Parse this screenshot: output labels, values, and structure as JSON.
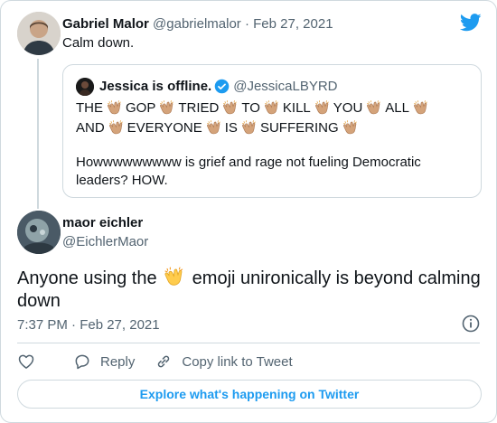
{
  "colors": {
    "twitter_blue": "#1d9bf0",
    "muted_text": "#536471",
    "border": "#cfd9de"
  },
  "parent_tweet": {
    "display_name": "Gabriel Malor",
    "handle": "@gabrielmalor",
    "separator": " · ",
    "date": "Feb 27, 2021",
    "text": "Calm down.",
    "quoted_tweet": {
      "display_name": "Jessica is offline.",
      "handle": "@JessicaLBYRD",
      "line1": [
        "THE",
        "GOP",
        "TRIED",
        "TO",
        "KILL",
        "YOU",
        "ALL"
      ],
      "line2": [
        "AND",
        "EVERYONE",
        "IS",
        "SUFFERING"
      ],
      "paragraph": "Howwwwwwwww is grief and rage not fueling Democratic leaders? HOW."
    }
  },
  "main_tweet": {
    "display_name": "maor eichler",
    "handle": "@EichlerMaor",
    "text_before": "Anyone using the ",
    "text_after": " emoji unironically is beyond calming down",
    "timestamp": "7:37 PM · Feb 27, 2021"
  },
  "actions": {
    "reply_label": "Reply",
    "copy_link_label": "Copy link to Tweet"
  },
  "explore_button_label": "Explore what's happening on Twitter",
  "icons": [
    "twitter-bird-icon",
    "verified-badge-icon",
    "clapping-hands-emoji",
    "info-icon",
    "heart-icon",
    "reply-icon",
    "link-icon"
  ]
}
